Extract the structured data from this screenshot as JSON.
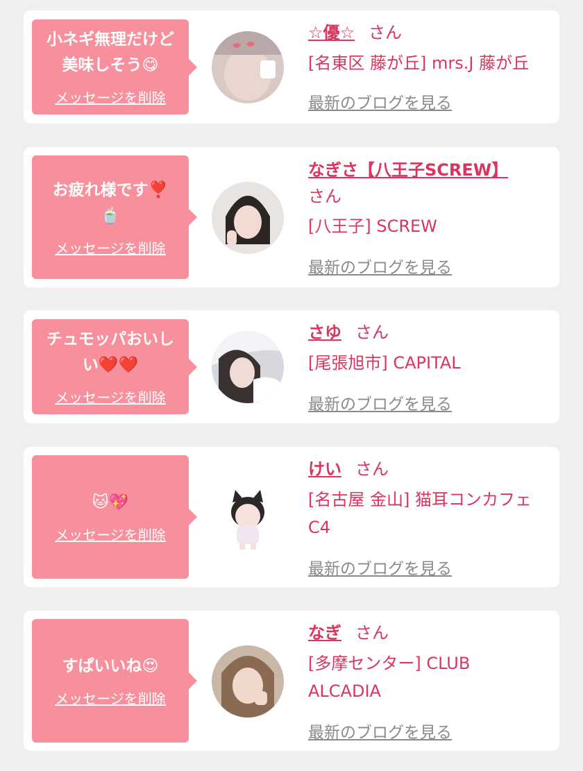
{
  "entries": [
    {
      "message": "小ネギ無理だけど\n美味しそう😋",
      "delete_label": "メッセージを削除",
      "name": "☆優☆",
      "honorific": "さん",
      "shop": "[名東区 藤が丘] mrs.J 藤が丘",
      "blog_label": "最新のブログを見る"
    },
    {
      "message": "お疲れ様です❣️\n🍵",
      "delete_label": "メッセージを削除",
      "name": "なぎさ【八王子SCREW】",
      "honorific": "さん",
      "shop": "[八王子] SCREW",
      "blog_label": "最新のブログを見る"
    },
    {
      "message": "チュモッパおいし\nい❤️❤️",
      "delete_label": "メッセージを削除",
      "name": "さゆ",
      "honorific": "さん",
      "shop": "[尾張旭市] CAPITAL",
      "blog_label": "最新のブログを見る"
    },
    {
      "message": "🐱💖",
      "delete_label": "メッセージを削除",
      "name": "けい",
      "honorific": "さん",
      "shop": "[名古屋 金山] 猫耳コンカフェ C4",
      "blog_label": "最新のブログを見る"
    },
    {
      "message": "すぱいいね😍",
      "delete_label": "メッセージを削除",
      "name": "なぎ",
      "honorific": "さん",
      "shop": "[多摩センター] CLUB ALCADIA",
      "blog_label": "最新のブログを見る"
    }
  ],
  "colors": {
    "page_bg": "#efefef",
    "card_bg": "#ffffff",
    "bubble_bg": "#f78f9c",
    "accent": "#d9355e",
    "link_gray": "#8a8a8a"
  },
  "icons": [
    "avatar-photo"
  ]
}
